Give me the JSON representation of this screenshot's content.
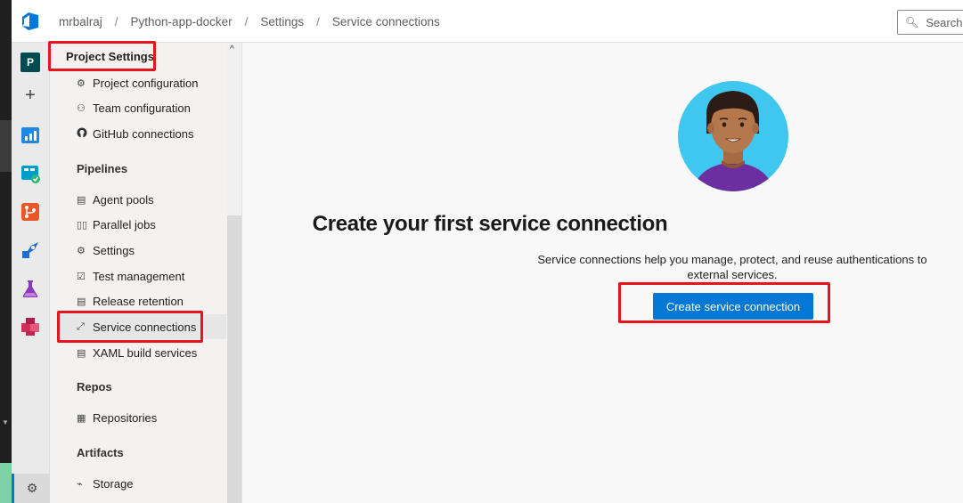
{
  "breadcrumb": [
    "mrbalraj",
    "Python-app-docker",
    "Settings",
    "Service connections"
  ],
  "search": {
    "label": "Search"
  },
  "rail": {
    "project_initial": "P",
    "add_label": "+"
  },
  "nav": {
    "title": "Project Settings",
    "general_items": [
      {
        "label": "Project configuration",
        "icon": "project-config-icon"
      },
      {
        "label": "Team configuration",
        "icon": "team-config-icon"
      },
      {
        "label": "GitHub connections",
        "icon": "github-icon"
      }
    ],
    "sections": {
      "pipelines": "Pipelines",
      "repos": "Repos",
      "artifacts": "Artifacts"
    },
    "pipelines_items": [
      {
        "label": "Agent pools",
        "icon": "agent-pool-icon"
      },
      {
        "label": "Parallel jobs",
        "icon": "parallel-jobs-icon"
      },
      {
        "label": "Settings",
        "icon": "gear-icon"
      },
      {
        "label": "Test management",
        "icon": "test-management-icon"
      },
      {
        "label": "Release retention",
        "icon": "release-retention-icon"
      },
      {
        "label": "Service connections",
        "icon": "service-connection-icon",
        "selected": true
      },
      {
        "label": "XAML build services",
        "icon": "xaml-build-icon"
      }
    ],
    "repos_items": [
      {
        "label": "Repositories",
        "icon": "repository-icon"
      }
    ],
    "artifacts_items": [
      {
        "label": "Storage",
        "icon": "storage-icon"
      }
    ]
  },
  "main": {
    "heading": "Create your first service connection",
    "description": "Service connections help you manage, protect, and reuse authentications to external services.",
    "cta_label": "Create service connection"
  },
  "colors": {
    "accent": "#0078d4",
    "highlight": "#e8141c"
  }
}
